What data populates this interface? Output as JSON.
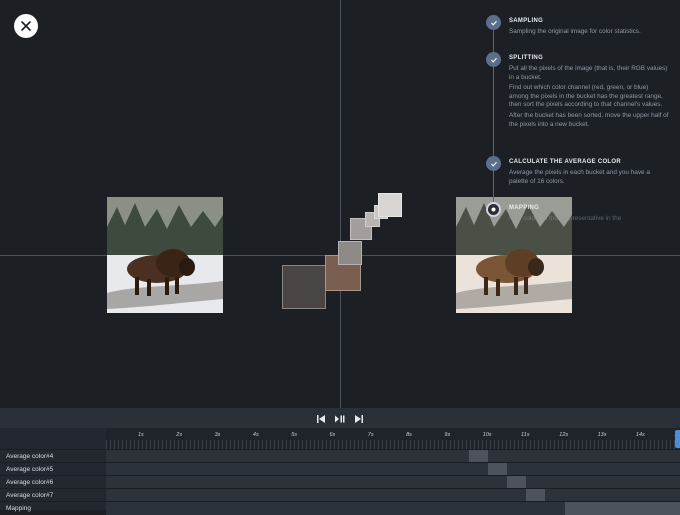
{
  "toolbar": {
    "close_icon": "close-icon"
  },
  "steps": [
    {
      "title": "SAMPLING",
      "paragraphs": [
        "Sampling the original image for color statistics."
      ],
      "state": "done"
    },
    {
      "title": "SPLITTING",
      "paragraphs": [
        "Put all the pixels of the image (that is, their RGB values) in a bucket.",
        "Find out which color channel (red, green, or blue) among the pixels in the bucket has the greatest range, then sort the pixels according to that channel's values.",
        "After the bucket has been sorted, move the upper half of the pixels into a new bucket."
      ],
      "state": "done"
    },
    {
      "title": "CALCULATE THE AVERAGE COLOR",
      "paragraphs": [
        "Average the pixels in each bucket and you have a palette of 16 colors."
      ],
      "state": "done"
    },
    {
      "title": "MAPPING",
      "paragraphs": [
        "Map colors to their representative in the"
      ],
      "state": "current"
    }
  ],
  "swatch_colors": [
    "#4a4545",
    "#7a5f50",
    "#8e8a88",
    "#a39e9c",
    "#b8b4b2",
    "#c9c6c4",
    "#d8d6d4"
  ],
  "timeline": {
    "controls": {
      "prev_icon": "skip-back-icon",
      "play_icon": "play-pause-icon",
      "next_icon": "skip-forward-icon"
    },
    "ticks": [
      "1s",
      "2s",
      "3s",
      "4s",
      "5s",
      "6s",
      "7s",
      "8s",
      "9s",
      "10s",
      "11s",
      "12s",
      "13s",
      "14s",
      "15"
    ],
    "rows": [
      {
        "label": "Average color#4"
      },
      {
        "label": "Average color#5"
      },
      {
        "label": "Average color#6"
      },
      {
        "label": "Average color#7"
      },
      {
        "label": "Mapping"
      }
    ]
  }
}
